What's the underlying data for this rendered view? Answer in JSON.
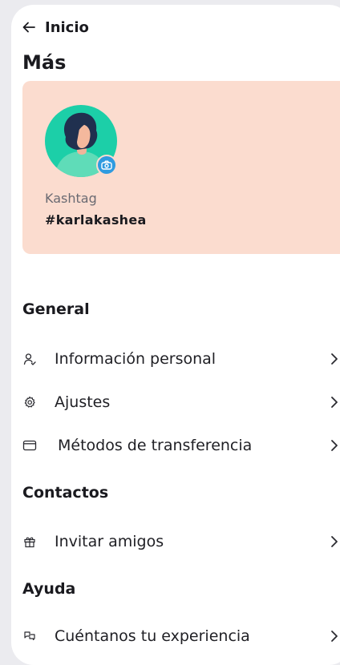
{
  "header": {
    "back_label": "Inicio",
    "title": "Más"
  },
  "profile": {
    "kashtag_label": "Kashtag",
    "kashtag_value": "#karlakashea",
    "card_color": "#fbdccf",
    "avatar_color": "#1ccfa8",
    "badge_color": "#2f9be0"
  },
  "sections": {
    "general": {
      "title": "General",
      "items": [
        {
          "label": "Información personal",
          "icon": "user-icon"
        },
        {
          "label": "Ajustes",
          "icon": "gear-icon"
        },
        {
          "label": "Métodos de transferencia",
          "icon": "wallet-icon"
        }
      ]
    },
    "contactos": {
      "title": "Contactos",
      "items": [
        {
          "label": "Invitar amigos",
          "icon": "gift-icon"
        }
      ]
    },
    "ayuda": {
      "title": "Ayuda",
      "items": [
        {
          "label": "Cuéntanos tu experiencia",
          "icon": "chat-icon"
        }
      ]
    }
  }
}
